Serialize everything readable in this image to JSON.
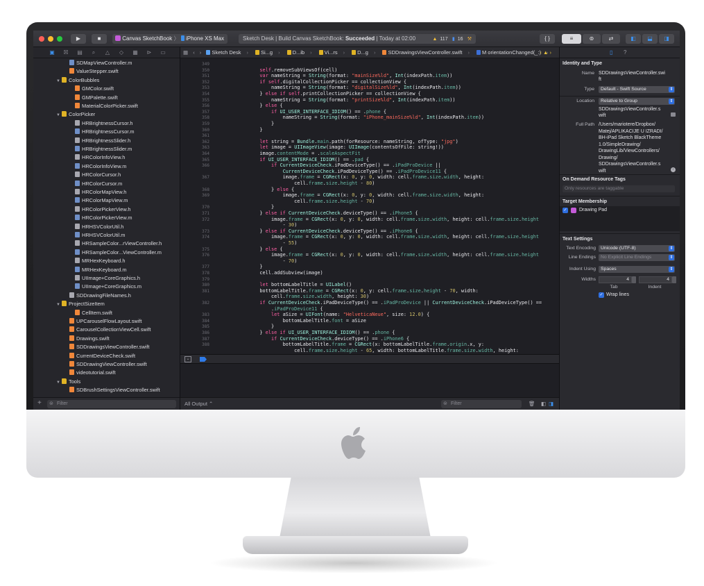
{
  "toolbar": {
    "scheme": "Canvas SketchBook",
    "device": "iPhone XS Max",
    "activity_prefix": "Sketch Desk | Build Canvas SketchBook:",
    "activity_status": "Succeeded",
    "activity_time": "| Today at 02:00",
    "warnings": "117",
    "issues": "16"
  },
  "jumpbar": [
    "Sketch Desk",
    "Si...g",
    "D...ib",
    "Vi...rs",
    "D...g",
    "SDDrawingsViewController.swift",
    "M orientationChanged(_:)"
  ],
  "navigator": {
    "rows": [
      {
        "label": "SDMapViewController.m",
        "icon": "m",
        "indent": 52
      },
      {
        "label": "ValueStepper.swift",
        "icon": "swift",
        "indent": 52
      },
      {
        "label": "ColorBubbles",
        "icon": "folder",
        "indent": 42,
        "open": true
      },
      {
        "label": "GMColor.swift",
        "icon": "swift",
        "indent": 60
      },
      {
        "label": "GMPalette.swift",
        "icon": "swift",
        "indent": 60
      },
      {
        "label": "MaterialColorPicker.swift",
        "icon": "swift",
        "indent": 60
      },
      {
        "label": "ColorPicker",
        "icon": "folder",
        "indent": 42,
        "open": true
      },
      {
        "label": "HRBrightnessCursor.h",
        "icon": "h",
        "indent": 60
      },
      {
        "label": "HRBrightnessCursor.m",
        "icon": "m",
        "indent": 60
      },
      {
        "label": "HRBrightnessSlider.h",
        "icon": "h",
        "indent": 60
      },
      {
        "label": "HRBrightnessSlider.m",
        "icon": "m",
        "indent": 60
      },
      {
        "label": "HRColorInfoView.h",
        "icon": "h",
        "indent": 60
      },
      {
        "label": "HRColorInfoView.m",
        "icon": "m",
        "indent": 60
      },
      {
        "label": "HRColorCursor.h",
        "icon": "h",
        "indent": 60
      },
      {
        "label": "HRColorCursor.m",
        "icon": "m",
        "indent": 60
      },
      {
        "label": "HRColorMapView.h",
        "icon": "h",
        "indent": 60
      },
      {
        "label": "HRColorMapView.m",
        "icon": "m",
        "indent": 60
      },
      {
        "label": "HRColorPickerView.h",
        "icon": "h",
        "indent": 60
      },
      {
        "label": "HRColorPickerView.m",
        "icon": "m",
        "indent": 60
      },
      {
        "label": "HRHSVColorUtil.h",
        "icon": "h",
        "indent": 60
      },
      {
        "label": "HRHSVColorUtil.m",
        "icon": "m",
        "indent": 60
      },
      {
        "label": "HRSampleColor...rViewController.h",
        "icon": "h",
        "indent": 60
      },
      {
        "label": "HRSampleColor...ViewController.m",
        "icon": "m",
        "indent": 60
      },
      {
        "label": "MRHexKeyboard.h",
        "icon": "h",
        "indent": 60
      },
      {
        "label": "MRHexKeyboard.m",
        "icon": "m",
        "indent": 60
      },
      {
        "label": "UIImage+CoreGraphics.h",
        "icon": "h",
        "indent": 60
      },
      {
        "label": "UIImage+CoreGraphics.m",
        "icon": "m",
        "indent": 60
      },
      {
        "label": "SDDrawingFileNames.h",
        "icon": "h",
        "indent": 52
      },
      {
        "label": "ProjectSizeItem",
        "icon": "folder",
        "indent": 42,
        "open": true
      },
      {
        "label": "CellItem.swift",
        "icon": "swift",
        "indent": 60
      },
      {
        "label": "UPCarouselFlowLayout.swift",
        "icon": "swift",
        "indent": 52
      },
      {
        "label": "CarouselCollectionViewCell.swift",
        "icon": "swift",
        "indent": 52
      },
      {
        "label": "Drawings.swift",
        "icon": "swift",
        "indent": 52
      },
      {
        "label": "SDDrawingsViewController.swift",
        "icon": "swift",
        "indent": 52
      },
      {
        "label": "CurrentDeviceCheck.swift",
        "icon": "swift",
        "indent": 52
      },
      {
        "label": "SDDrawingViewController.swift",
        "icon": "swift",
        "indent": 52
      },
      {
        "label": "videotutorial.swift",
        "icon": "swift",
        "indent": 52
      },
      {
        "label": "Tools",
        "icon": "folder",
        "indent": 42,
        "open": true
      },
      {
        "label": "SDBrushSettingsViewController.swift",
        "icon": "swift",
        "indent": 52
      }
    ],
    "filter_placeholder": "Filter"
  },
  "code": [
    [
      "349",
      ""
    ],
    [
      "350",
      "                self.removeSubViewsOf(cell)"
    ],
    [
      "351",
      "                var nameString = String(format: \"mainSize%ld\", Int(indexPath.item))"
    ],
    [
      "352",
      "                if self.digitalCollectionPicker == collectionView {"
    ],
    [
      "353",
      "                    nameString = String(format: \"digitalSize%ld\", Int(indexPath.item))"
    ],
    [
      "354",
      "                } else if self.printCollectionPicker == collectionView {"
    ],
    [
      "355",
      "                    nameString = String(format: \"printSize%ld\", Int(indexPath.item))"
    ],
    [
      "356",
      "                } else {"
    ],
    [
      "357",
      "                    if UI_USER_INTERFACE_IDIOM() == .phone {"
    ],
    [
      "358",
      "                        nameString = String(format: \"iPhone_mainSize%ld\", Int(indexPath.item))"
    ],
    [
      "359",
      "                    }"
    ],
    [
      "360",
      "                }"
    ],
    [
      "361",
      ""
    ],
    [
      "362",
      "                let string = Bundle.main.path(forResource: nameString, ofType: \"jpg\")"
    ],
    [
      "363",
      "                let image = UIImageView(image: UIImage(contentsOfFile: string!))"
    ],
    [
      "364",
      "                image.contentMode = .scaleAspectFit"
    ],
    [
      "365",
      "                if UI_USER_INTERFACE_IDIOM() == .pad {"
    ],
    [
      "366",
      "                    if CurrentDeviceCheck.iPadDeviceType() == .iPadProDevice ||"
    ],
    [
      "",
      "                        CurrentDeviceCheck.iPadDeviceType() == .iPadProDevice11 {"
    ],
    [
      "367",
      "                        image.frame = CGRect(x: 0, y: 0, width: cell.frame.size.width, height:"
    ],
    [
      "",
      "                            cell.frame.size.height - 80)"
    ],
    [
      "368",
      "                    } else {"
    ],
    [
      "369",
      "                        image.frame = CGRect(x: 0, y: 0, width: cell.frame.size.width, height:"
    ],
    [
      "",
      "                            cell.frame.size.height - 70)"
    ],
    [
      "370",
      "                    }"
    ],
    [
      "371",
      "                } else if CurrentDeviceCheck.deviceType() == .iPhone5 {"
    ],
    [
      "372",
      "                    image.frame = CGRect(x: 0, y: 0, width: cell.frame.size.width, height: cell.frame.size.height"
    ],
    [
      "",
      "                        - 30)"
    ],
    [
      "373",
      "                } else if CurrentDeviceCheck.deviceType() == .iPhone6 {"
    ],
    [
      "374",
      "                    image.frame = CGRect(x: 0, y: 0, width: cell.frame.size.width, height: cell.frame.size.height"
    ],
    [
      "",
      "                        - 55)"
    ],
    [
      "375",
      "                } else {"
    ],
    [
      "376",
      "                    image.frame = CGRect(x: 0, y: 0, width: cell.frame.size.width, height: cell.frame.size.height"
    ],
    [
      "",
      "                        - 70)"
    ],
    [
      "377",
      "                }"
    ],
    [
      "378",
      "                cell.addSubview(image)"
    ],
    [
      "379",
      ""
    ],
    [
      "380",
      "                let bottomLabelTitle = UILabel()"
    ],
    [
      "381",
      "                bottomLabelTitle.frame = CGRect(x: 0, y: cell.frame.size.height - 70, width:"
    ],
    [
      "",
      "                    cell.frame.size.width, height: 30)"
    ],
    [
      "382",
      "                if CurrentDeviceCheck.iPadDeviceType() == .iPadProDevice || CurrentDeviceCheck.iPadDeviceType() =="
    ],
    [
      "",
      "                    .iPadProDevice11 {"
    ],
    [
      "383",
      "                    let aSize = UIFont(name: \"HelveticaNeue\", size: 12.0) {"
    ],
    [
      "384",
      "                        bottomLabelTitle.font = aSize"
    ],
    [
      "385",
      "                    }"
    ],
    [
      "386",
      "                } else if UI_USER_INTERFACE_IDIOM() == .phone {"
    ],
    [
      "387",
      "                    if CurrentDeviceCheck.deviceType() == .iPhone6 {"
    ],
    [
      "388",
      "                        bottomLabelTitle.frame = CGRect(x: bottomLabelTitle.frame.origin.x, y:"
    ],
    [
      "",
      "                            cell.frame.size.height - 65, width: bottomLabelTitle.frame.size.width, height:"
    ]
  ],
  "console": {
    "output_label": "All Output",
    "filter_placeholder": "Filter"
  },
  "inspector": {
    "identity_heading": "Identity and Type",
    "name_label": "Name",
    "name_value_1": "SDDrawingsViewController.swi",
    "name_value_2": "ft",
    "type_label": "Type",
    "type_value": "Default - Swift Source",
    "location_label": "Location",
    "location_value": "Relative to Group",
    "location_file_1": "SDDrawingsViewController.s",
    "location_file_2": "wift",
    "fullpath_label": "Full Path",
    "fullpath_lines": [
      "/Users/mariotere/Dropbox/",
      "Matej/APLIKACIJE U IZRADI/",
      "BH-iPad Sketch BlackTheme",
      "1.0/SimpleDrawing/",
      "DrawingLib/ViewControllers/",
      "Drawing/",
      "SDDrawingsViewController.s",
      "wift"
    ],
    "odr_heading": "On Demand Resource Tags",
    "odr_placeholder": "Only resources are taggable",
    "target_heading": "Target Membership",
    "target_name": "Drawing Pad",
    "text_heading": "Text Settings",
    "encoding_label": "Text Encoding",
    "encoding_value": "Unicode (UTF-8)",
    "line_endings_label": "Line Endings",
    "line_endings_value": "No Explicit Line Endings",
    "indent_label": "Indent Using",
    "indent_value": "Spaces",
    "widths_label": "Widths",
    "tab_width": "4",
    "indent_width": "4",
    "tab_label": "Tab",
    "indent_sub_label": "Indent",
    "wrap_label": "Wrap lines"
  }
}
